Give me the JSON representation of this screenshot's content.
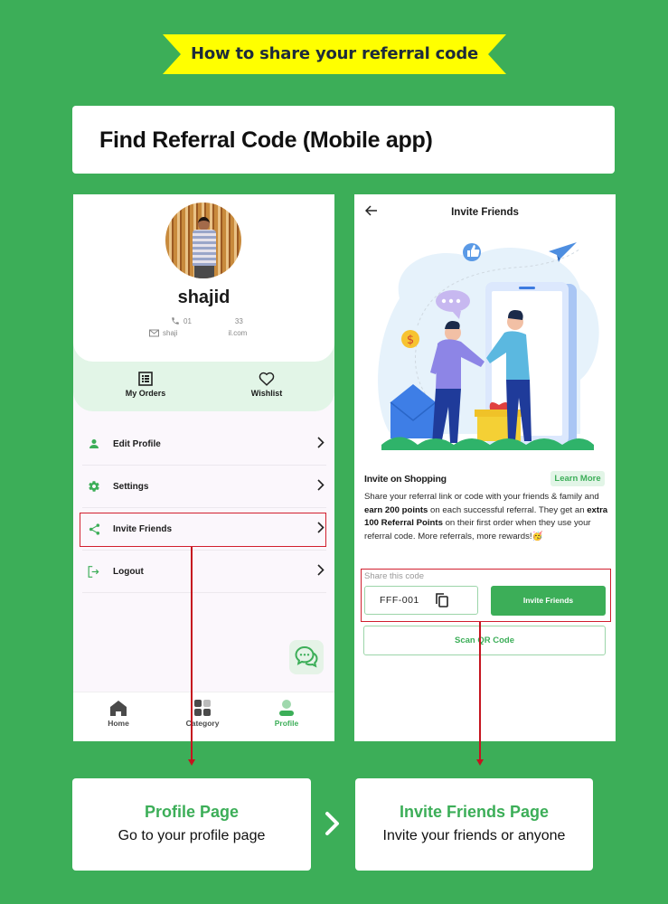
{
  "banner": {
    "text": "How to share your referral code",
    "bg_color": "#ffff00"
  },
  "title_card": {
    "title": "Find Referral Code (Mobile app)"
  },
  "colors": {
    "background": "#3cae58",
    "accent": "#3cae58",
    "highlight": "#d11f2e"
  },
  "profile_screen": {
    "username": "shajid",
    "phone": {
      "start": "01",
      "end": "33",
      "icon": "phone-icon"
    },
    "email": {
      "start": "shaji",
      "end": "il.com",
      "icon": "mail-icon"
    },
    "quick_links": [
      {
        "label": "My Orders",
        "icon": "orders-list-icon"
      },
      {
        "label": "Wishlist",
        "icon": "heart-icon"
      }
    ],
    "menu": [
      {
        "label": "Edit Profile",
        "icon": "person-icon"
      },
      {
        "label": "Settings",
        "icon": "gear-icon"
      },
      {
        "label": "Invite Friends",
        "icon": "share-icon",
        "highlighted": true
      },
      {
        "label": "Logout",
        "icon": "logout-icon"
      }
    ],
    "bottom_nav": [
      {
        "label": "Home",
        "icon": "home-icon"
      },
      {
        "label": "Category",
        "icon": "category-grid-icon"
      },
      {
        "label": "Profile",
        "icon": "profile-icon",
        "active": true
      }
    ]
  },
  "invite_screen": {
    "title": "Invite Friends",
    "back_icon": "arrow-left-icon",
    "section_title": "Invite on Shopping",
    "learn_more": "Learn More",
    "description": {
      "p1": "Share your referral link or code with your friends & family and ",
      "b1": "earn 200 points",
      "p2": " on each successful referral. They get an ",
      "b2": "extra 100 Referral Points",
      "p3": " on their first order when they use your referral code. More referrals, more rewards!",
      "emoji": "🥳"
    },
    "share_label": "Share this code",
    "referral_code": "FFF-001",
    "invite_button": "Invite Friends",
    "qr_button": "Scan QR Code"
  },
  "steps": [
    {
      "title": "Profile Page",
      "description": "Go to your profile page"
    },
    {
      "title": "Invite Friends Page",
      "description": "Invite your friends or anyone"
    }
  ]
}
